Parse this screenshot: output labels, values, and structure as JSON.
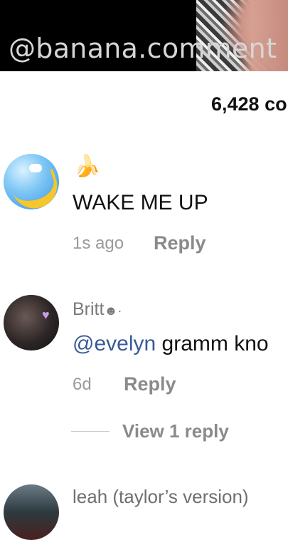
{
  "header": {
    "watermark": "@banana.comment",
    "comment_count": "6,428 co"
  },
  "comments": [
    {
      "name": "🍌",
      "text": "WAKE ME UP",
      "time": "1s ago",
      "reply_label": "Reply"
    },
    {
      "name": "Britt",
      "name_badge": "☻·",
      "mention": "@evelyn",
      "text": " gramm kno",
      "time": "6d",
      "reply_label": "Reply",
      "view_replies": "View 1 reply"
    },
    {
      "name": "leah (taylor’s version)"
    }
  ],
  "colors": {
    "mention": "#3b5998",
    "reply": "#8a8a8a",
    "meta": "#9a9a9a"
  }
}
